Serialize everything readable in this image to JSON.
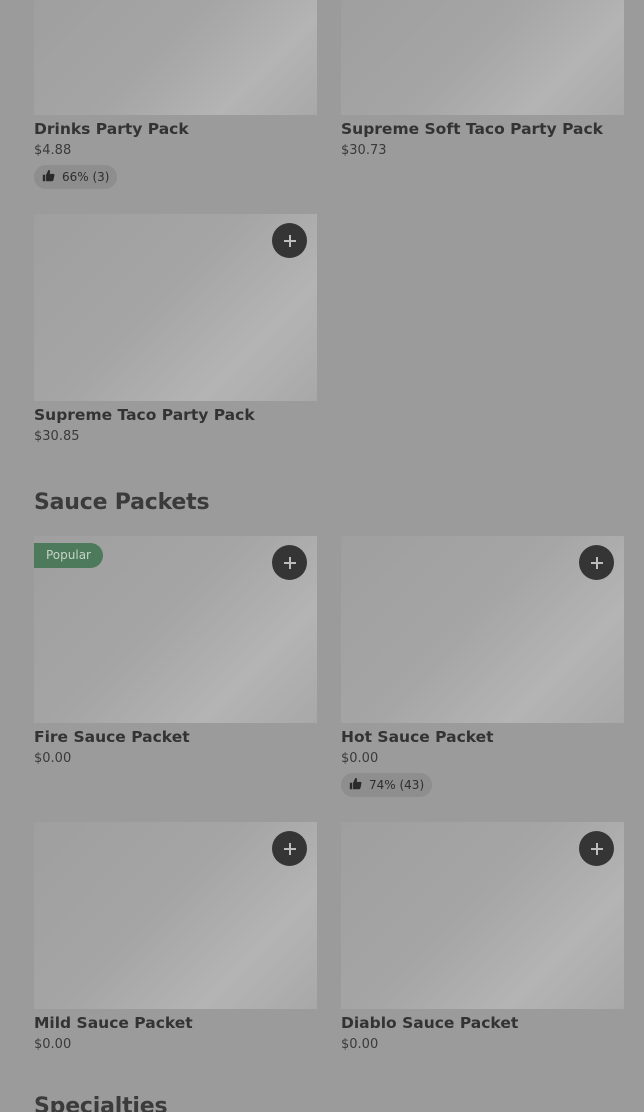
{
  "sections": {
    "sauce_packets_title": "Sauce Packets",
    "specialties_title": "Specialties"
  },
  "items": {
    "drinks_party_pack": {
      "name": "Drinks Party Pack",
      "price": "$4.88",
      "rating": "66% (3)"
    },
    "supreme_soft_taco_party_pack": {
      "name": "Supreme Soft Taco Party Pack",
      "price": "$30.73"
    },
    "supreme_taco_party_pack": {
      "name": "Supreme Taco Party Pack",
      "price": "$30.85"
    },
    "fire_sauce_packet": {
      "name": "Fire Sauce Packet",
      "price": "$0.00",
      "badge": "Popular"
    },
    "hot_sauce_packet": {
      "name": "Hot Sauce Packet",
      "price": "$0.00",
      "rating": "74% (43)"
    },
    "mild_sauce_packet": {
      "name": "Mild Sauce Packet",
      "price": "$0.00"
    },
    "diablo_sauce_packet": {
      "name": "Diablo Sauce Packet",
      "price": "$0.00"
    }
  },
  "icons": {
    "add": "plus-icon",
    "rating": "thumbs-up-icon"
  },
  "colors": {
    "badge_popular": "#4c7a5b",
    "add_button": "#353535"
  }
}
